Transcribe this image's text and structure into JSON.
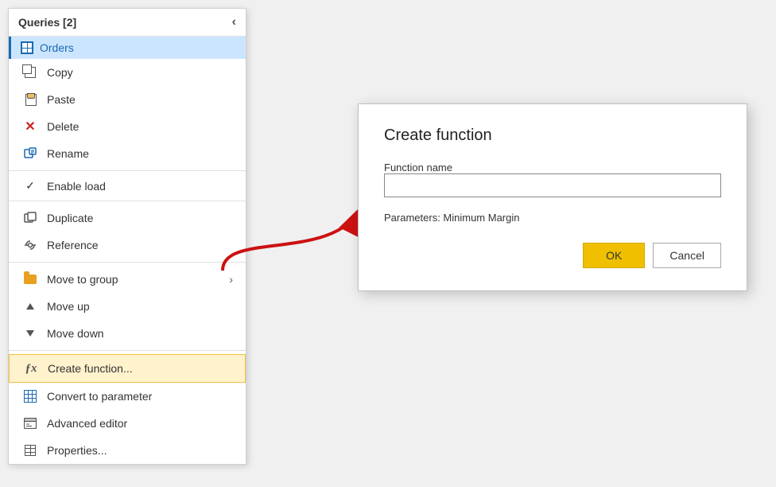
{
  "panel": {
    "title": "Queries [2]",
    "collapse_label": "‹",
    "orders_label": "Orders"
  },
  "menu": {
    "copy": "Copy",
    "paste": "Paste",
    "delete": "Delete",
    "rename": "Rename",
    "enable_load": "Enable load",
    "duplicate": "Duplicate",
    "reference": "Reference",
    "move_to_group": "Move to group",
    "move_up": "Move up",
    "move_down": "Move down",
    "create_function": "Create function...",
    "convert_to_parameter": "Convert to parameter",
    "advanced_editor": "Advanced editor",
    "properties": "Properties..."
  },
  "dialog": {
    "title": "Create function",
    "function_name_label": "Function name",
    "function_name_value": "",
    "function_name_placeholder": "",
    "parameters_label": "Parameters: Minimum Margin",
    "ok_label": "OK",
    "cancel_label": "Cancel"
  },
  "colors": {
    "ok_bg": "#f0c000",
    "ok_border": "#d4a800",
    "highlight_bg": "#cce5ff",
    "menu_highlight_bg": "#fff2cc"
  }
}
